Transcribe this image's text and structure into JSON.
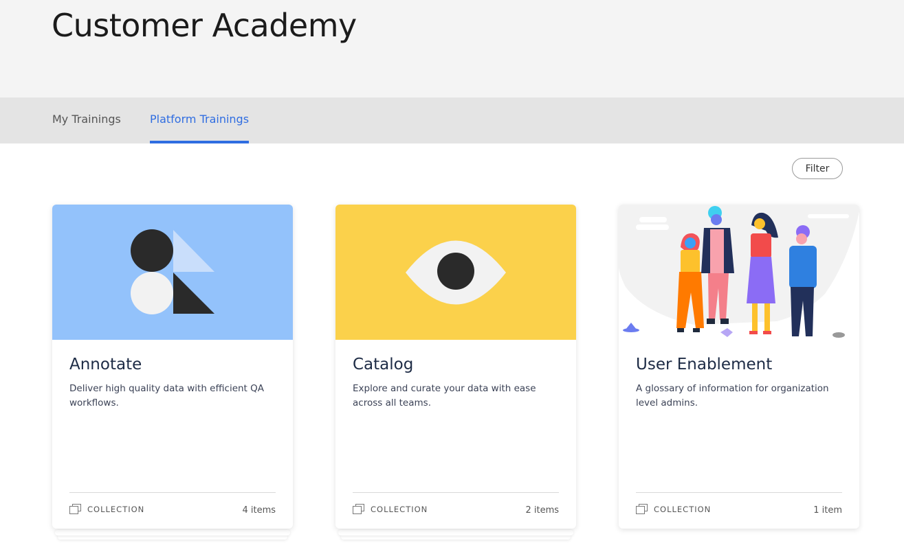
{
  "header": {
    "title": "Customer Academy"
  },
  "tabs": [
    {
      "label": "My Trainings",
      "active": false
    },
    {
      "label": "Platform Trainings",
      "active": true
    }
  ],
  "toolbar": {
    "filter_label": "Filter"
  },
  "colors": {
    "accent": "#2f6de1",
    "annotate_bg": "#93c2fb",
    "catalog_bg": "#fbd14b"
  },
  "cards": [
    {
      "title": "Annotate",
      "description": "Deliver high quality data with efficient QA workflows.",
      "type_label": "COLLECTION",
      "count": "4 items",
      "image": "annotate-shapes-illustration"
    },
    {
      "title": "Catalog",
      "description": "Explore and curate your data with ease across all teams.",
      "type_label": "COLLECTION",
      "count": "2 items",
      "image": "eye-illustration"
    },
    {
      "title": "User Enablement",
      "description": "A glossary of information for organization level admins.",
      "type_label": "COLLECTION",
      "count": "1 item",
      "image": "people-group-illustration"
    }
  ]
}
